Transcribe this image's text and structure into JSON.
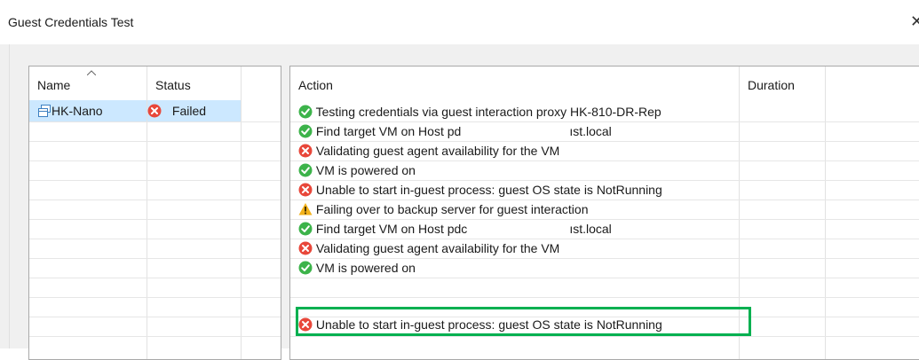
{
  "window": {
    "title": "Guest Credentials Test",
    "close_glyph": "✕"
  },
  "left_table": {
    "columns": {
      "name": "Name",
      "status": "Status"
    },
    "rows": [
      {
        "name": "HK-Nano",
        "status": "Failed",
        "icon": "vm-icon",
        "status_icon": "error-icon"
      }
    ]
  },
  "right_table": {
    "columns": {
      "action": "Action",
      "duration": "Duration"
    },
    "rows": [
      {
        "status": "success",
        "text": "Testing credentials via guest interaction proxy HK-810-DR-Rep"
      },
      {
        "status": "success",
        "text_a": "Find target VM on Host pd",
        "text_b": "ıst.local"
      },
      {
        "status": "error",
        "text": "Validating guest agent availability for the VM"
      },
      {
        "status": "success",
        "text": "VM is powered on"
      },
      {
        "status": "error",
        "text": "Unable to start in-guest process: guest OS state is NotRunning"
      },
      {
        "status": "warning",
        "text": "Failing over to backup server for guest interaction"
      },
      {
        "status": "success",
        "text_a": "Find target VM on Host pdc",
        "text_b": "ıst.local"
      },
      {
        "status": "error",
        "text": "Validating guest agent availability for the VM"
      },
      {
        "status": "success",
        "text": "VM is powered on"
      },
      {
        "status": "error",
        "text": "Unable to start in-guest process: guest OS state is NotRunning"
      }
    ]
  },
  "colors": {
    "success": "#3cb34a",
    "error": "#e8473a",
    "warning": "#f3b21a",
    "selection": "#cce8ff",
    "highlight_box": "#00b050"
  }
}
